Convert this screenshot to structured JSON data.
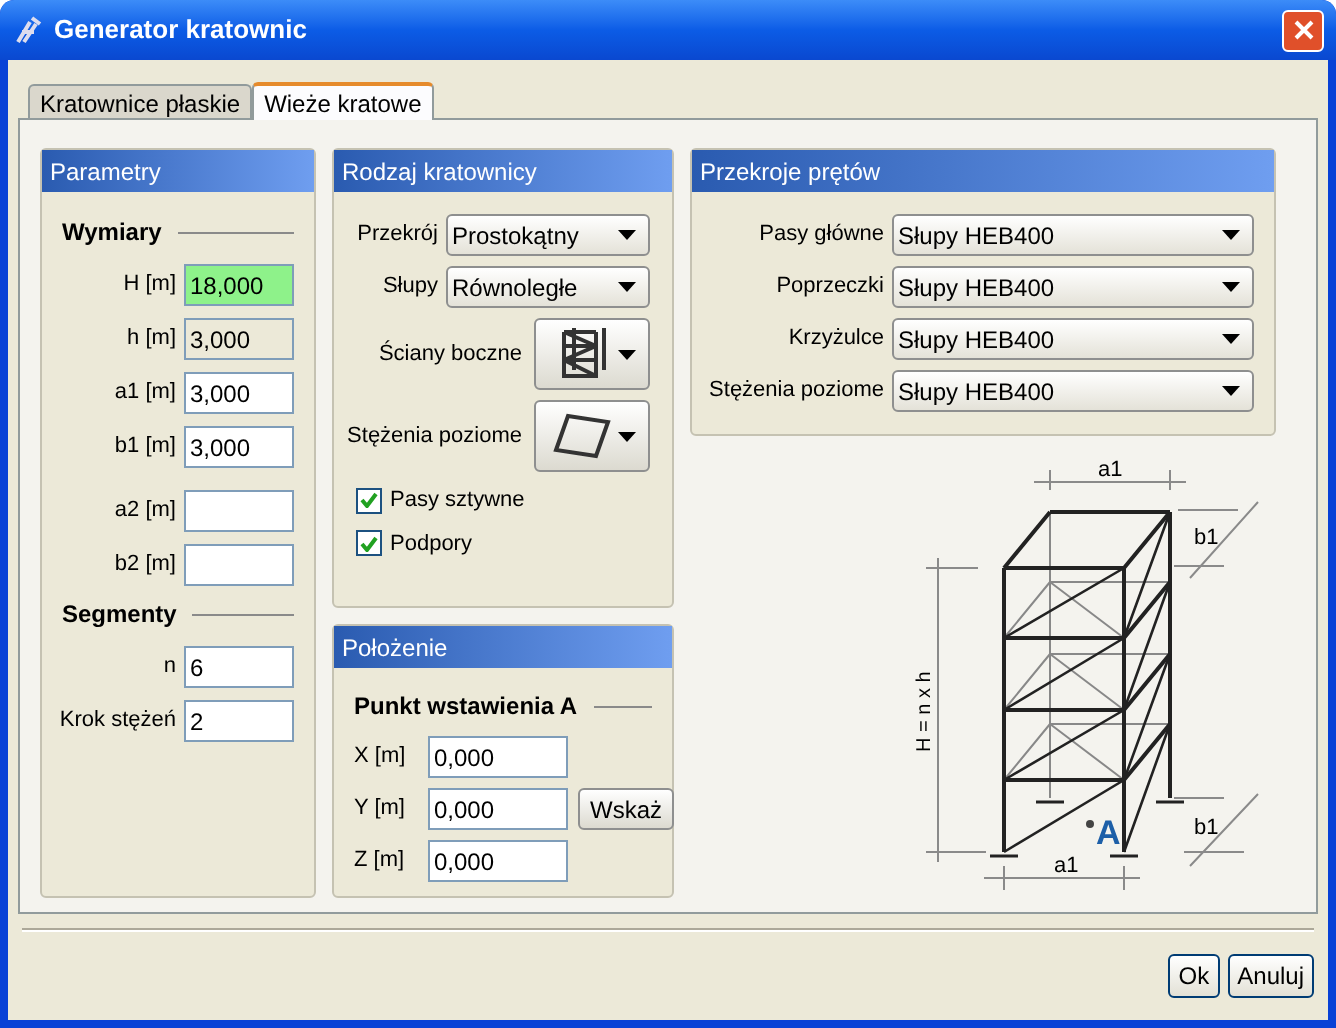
{
  "window": {
    "title": "Generator kratownic"
  },
  "tabs": [
    {
      "label": "Kratownice płaskie",
      "selected": false
    },
    {
      "label": "Wieże kratowe",
      "selected": true
    }
  ],
  "parametry": {
    "title": "Parametry",
    "sections": [
      {
        "heading": "Wymiary",
        "fields": [
          {
            "label": "H [m]",
            "value": "18,000",
            "highlighted": true,
            "readonly": false
          },
          {
            "label": "h [m]",
            "value": "3,000",
            "highlighted": false,
            "readonly": true
          },
          {
            "label": "a1 [m]",
            "value": "3,000",
            "highlighted": false,
            "readonly": false
          },
          {
            "label": "b1 [m]",
            "value": "3,000",
            "highlighted": false,
            "readonly": false
          },
          {
            "label": "a2 [m]",
            "highlighted": false,
            "readonly": false
          },
          {
            "label": "b2 [m]",
            "highlighted": false,
            "readonly": false
          }
        ]
      },
      {
        "heading": "Segmenty",
        "fields": [
          {
            "label": "n",
            "value": "6",
            "highlighted": false,
            "readonly": false
          },
          {
            "label": "Krok stężeń",
            "value": "2",
            "highlighted": false,
            "readonly": false
          }
        ]
      }
    ]
  },
  "rodzaj": {
    "title": "Rodzaj kratownicy",
    "selects": [
      {
        "label": "Przekrój",
        "value": "Prostokątny"
      },
      {
        "label": "Słupy",
        "value": "Równoległe"
      }
    ],
    "pickers": [
      {
        "label": "Ściany boczne",
        "kind": "walls"
      },
      {
        "label": "Stężenia poziome",
        "kind": "bracing"
      }
    ],
    "checkboxes": [
      {
        "label": "Pasy sztywne",
        "checked": true
      },
      {
        "label": "Podpory",
        "checked": true
      }
    ]
  },
  "polozenie": {
    "title": "Położenie",
    "heading": "Punkt wstawienia A",
    "fields": [
      {
        "label": "X [m]",
        "value": "0,000"
      },
      {
        "label": "Y [m]",
        "value": "0,000",
        "button": "Wskaż"
      },
      {
        "label": "Z [m]",
        "value": "0,000"
      }
    ]
  },
  "przekroje": {
    "title": "Przekroje prętów",
    "selects": [
      {
        "label": "Pasy główne",
        "value": "Słupy HEB400"
      },
      {
        "label": "Poprzeczki",
        "value": "Słupy HEB400"
      },
      {
        "label": "Krzyżulce",
        "value": "Słupy HEB400"
      },
      {
        "label": "Stężenia poziome",
        "value": "Słupy HEB400"
      }
    ]
  },
  "diagram": {
    "top_width": "a1",
    "top_depth": "b1",
    "height": "H = n x h",
    "bottom_width": "a1",
    "bottom_depth": "b1",
    "point": "A"
  },
  "buttons": [
    "Ok",
    "Anuluj"
  ]
}
